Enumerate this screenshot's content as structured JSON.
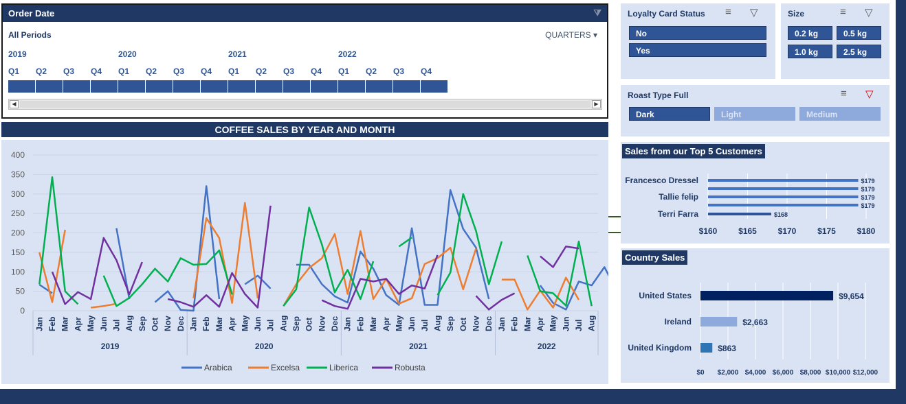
{
  "timeline": {
    "title": "Order Date",
    "period_label": "All Periods",
    "level_label": "QUARTERS",
    "years": [
      "2019",
      "2020",
      "2021",
      "2022"
    ],
    "quarters": [
      "Q1",
      "Q2",
      "Q3",
      "Q4",
      "Q1",
      "Q2",
      "Q3",
      "Q4",
      "Q1",
      "Q2",
      "Q3",
      "Q4",
      "Q1",
      "Q2",
      "Q3",
      "Q4"
    ]
  },
  "loyalty": {
    "title": "Loyalty Card Status",
    "items": [
      "No",
      "Yes"
    ]
  },
  "size": {
    "title": "Size",
    "items": [
      "0.2 kg",
      "0.5 kg",
      "1.0 kg",
      "2.5 kg"
    ]
  },
  "roast": {
    "title": "Roast Type Full",
    "items": [
      "Dark",
      "Light",
      "Medium"
    ],
    "selected": "Dark"
  },
  "chart_data": [
    {
      "type": "line",
      "title": "COFFEE SALES BY YEAR AND MONTH",
      "ylim": [
        0,
        400
      ],
      "yticks": [
        0,
        50,
        100,
        150,
        200,
        250,
        300,
        350,
        400
      ],
      "years": [
        {
          "label": "2019",
          "months": [
            "Jan",
            "Feb",
            "Mar",
            "Apr",
            "May",
            "Jun",
            "Jul",
            "Aug",
            "Sep",
            "Oct",
            "Nov",
            "Dec"
          ]
        },
        {
          "label": "2020",
          "months": [
            "Jan",
            "Feb",
            "Mar",
            "Apr",
            "May",
            "Jun",
            "Jul",
            "Aug",
            "Sep",
            "Oct",
            "Nov",
            "Dec"
          ]
        },
        {
          "label": "2021",
          "months": [
            "Jan",
            "Feb",
            "Mar",
            "Apr",
            "May",
            "Jun",
            "Jul",
            "Aug",
            "Sep",
            "Oct",
            "Nov",
            "Dec"
          ]
        },
        {
          "label": "2022",
          "months": [
            "Jan",
            "Feb",
            "Mar",
            "Apr",
            "May",
            "Jun",
            "Jul",
            "Aug"
          ]
        }
      ],
      "series": [
        {
          "name": "Arabica",
          "color": "#4472c4",
          "values": [
            67,
            45,
            null,
            null,
            null,
            null,
            212,
            30,
            null,
            22,
            50,
            2,
            0,
            320,
            30,
            null,
            68,
            90,
            57,
            null,
            118,
            118,
            68,
            37,
            21,
            152,
            108,
            40,
            15,
            212,
            15,
            15,
            310,
            210,
            162,
            30,
            null,
            null,
            null,
            65,
            20,
            3,
            75,
            65,
            112,
            48
          ]
        },
        {
          "name": "Excelsa",
          "color": "#ed7d31",
          "values": [
            150,
            22,
            208,
            null,
            8,
            12,
            18,
            null,
            null,
            null,
            null,
            null,
            32,
            238,
            187,
            20,
            277,
            32,
            null,
            12,
            68,
            110,
            135,
            197,
            43,
            205,
            30,
            82,
            18,
            32,
            120,
            135,
            162,
            55,
            160,
            null,
            80,
            80,
            3,
            52,
            8,
            85,
            28,
            null
          ]
        },
        {
          "name": "Liberica",
          "color": "#00b050",
          "values": [
            68,
            343,
            50,
            17,
            null,
            90,
            12,
            33,
            68,
            108,
            75,
            135,
            118,
            120,
            155,
            42,
            null,
            null,
            null,
            12,
            55,
            265,
            170,
            47,
            105,
            30,
            127,
            null,
            165,
            188,
            null,
            40,
            98,
            300,
            205,
            68,
            178,
            null,
            142,
            50,
            45,
            13,
            178,
            12
          ]
        },
        {
          "name": "Robusta",
          "color": "#7030a0",
          "values": [
            null,
            100,
            17,
            48,
            30,
            187,
            130,
            42,
            125,
            null,
            30,
            22,
            10,
            40,
            10,
            97,
            43,
            8,
            270,
            null,
            null,
            null,
            27,
            12,
            5,
            82,
            75,
            82,
            43,
            65,
            57,
            143,
            null,
            null,
            38,
            3,
            28,
            45,
            null,
            140,
            112,
            165,
            160,
            null
          ]
        }
      ]
    },
    {
      "type": "bar",
      "title": "Sales from our Top 5 Customers",
      "categories": [
        "Francesco Dressel",
        "Tallie felip",
        "Terri Farra"
      ],
      "values": [
        179,
        179,
        179,
        179,
        168
      ],
      "value_labels": [
        "$179",
        "$179",
        "$179",
        "$179",
        "$168"
      ],
      "xlim": [
        160,
        180
      ],
      "xticks": [
        "$160",
        "$165",
        "$170",
        "$175",
        "$180"
      ]
    },
    {
      "type": "bar",
      "title": "Country Sales",
      "categories": [
        "United States",
        "Ireland",
        "United Kingdom"
      ],
      "values": [
        9654,
        2663,
        863
      ],
      "value_labels": [
        "$9,654",
        "$2,663",
        "$863"
      ],
      "colors": [
        "#002060",
        "#8ea9db",
        "#2e75b6"
      ],
      "xlim": [
        0,
        12000
      ],
      "xticks": [
        "$0",
        "$2,000",
        "$4,000",
        "$6,000",
        "$8,000",
        "$10,000",
        "$12,000"
      ]
    }
  ]
}
